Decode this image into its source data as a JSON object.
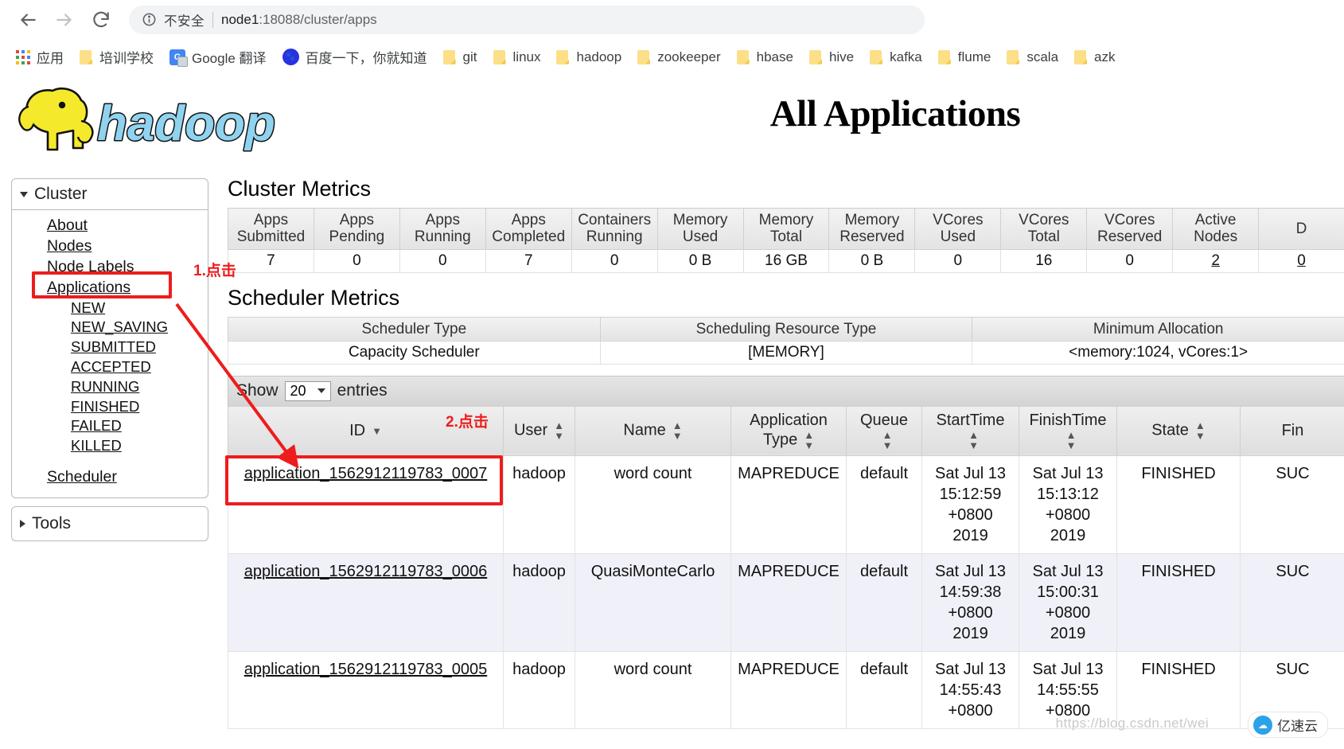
{
  "browser": {
    "back_icon": "back-arrow-icon",
    "forward_icon": "forward-arrow-icon",
    "reload_icon": "reload-icon",
    "info_icon": "info-circle-icon",
    "security_label": "不安全",
    "url_host": "node1",
    "url_rest": ":18088/cluster/apps",
    "bookmarks": [
      {
        "label": "应用",
        "icon": "apps-grid-icon"
      },
      {
        "label": "培训学校",
        "icon": "folder-icon"
      },
      {
        "label": "Google 翻译",
        "icon": "google-translate-icon"
      },
      {
        "label": "百度一下，你就知道",
        "icon": "baidu-icon"
      },
      {
        "label": "git",
        "icon": "folder-icon"
      },
      {
        "label": "linux",
        "icon": "folder-icon"
      },
      {
        "label": "hadoop",
        "icon": "folder-icon"
      },
      {
        "label": "zookeeper",
        "icon": "folder-icon"
      },
      {
        "label": "hbase",
        "icon": "folder-icon"
      },
      {
        "label": "hive",
        "icon": "folder-icon"
      },
      {
        "label": "kafka",
        "icon": "folder-icon"
      },
      {
        "label": "flume",
        "icon": "folder-icon"
      },
      {
        "label": "scala",
        "icon": "folder-icon"
      },
      {
        "label": "azk",
        "icon": "folder-icon"
      }
    ]
  },
  "page": {
    "logo_text": "hadoop",
    "title": "All Applications"
  },
  "sidebar": {
    "cluster_header": "Cluster",
    "tools_header": "Tools",
    "links": [
      {
        "label": "About",
        "sub": false
      },
      {
        "label": "Nodes",
        "sub": false
      },
      {
        "label": "Node Labels",
        "sub": false
      },
      {
        "label": "Applications",
        "sub": false
      },
      {
        "label": "NEW",
        "sub": true
      },
      {
        "label": "NEW_SAVING",
        "sub": true
      },
      {
        "label": "SUBMITTED",
        "sub": true
      },
      {
        "label": "ACCEPTED",
        "sub": true
      },
      {
        "label": "RUNNING",
        "sub": true
      },
      {
        "label": "FINISHED",
        "sub": true
      },
      {
        "label": "FAILED",
        "sub": true
      },
      {
        "label": "KILLED",
        "sub": true
      }
    ],
    "scheduler_link": "Scheduler"
  },
  "cluster_metrics": {
    "heading": "Cluster Metrics",
    "columns": [
      "Apps Submitted",
      "Apps Pending",
      "Apps Running",
      "Apps Completed",
      "Containers Running",
      "Memory Used",
      "Memory Total",
      "Memory Reserved",
      "VCores Used",
      "VCores Total",
      "VCores Reserved",
      "Active Nodes",
      "D"
    ],
    "values": [
      "7",
      "0",
      "0",
      "7",
      "0",
      "0 B",
      "16 GB",
      "0 B",
      "0",
      "16",
      "0",
      "2",
      "0"
    ]
  },
  "scheduler_metrics": {
    "heading": "Scheduler Metrics",
    "columns": [
      "Scheduler Type",
      "Scheduling Resource Type",
      "Minimum Allocation"
    ],
    "values": [
      "Capacity Scheduler",
      "[MEMORY]",
      "<memory:1024, vCores:1>"
    ]
  },
  "datatable": {
    "show_label": "Show",
    "entries_value": "20",
    "entries_label": "entries",
    "columns": [
      "ID",
      "User",
      "Name",
      "Application Type",
      "Queue",
      "StartTime",
      "FinishTime",
      "State",
      "Fin"
    ],
    "rows": [
      {
        "id": "application_1562912119783_0007",
        "user": "hadoop",
        "name": "word count",
        "app_type": "MAPREDUCE",
        "queue": "default",
        "start_time": "Sat Jul 13\n15:12:59\n+0800\n2019",
        "finish_time": "Sat Jul 13\n15:13:12\n+0800\n2019",
        "state": "FINISHED",
        "final_status": "SUC"
      },
      {
        "id": "application_1562912119783_0006",
        "user": "hadoop",
        "name": "QuasiMonteCarlo",
        "app_type": "MAPREDUCE",
        "queue": "default",
        "start_time": "Sat Jul 13\n14:59:38\n+0800\n2019",
        "finish_time": "Sat Jul 13\n15:00:31\n+0800\n2019",
        "state": "FINISHED",
        "final_status": "SUC"
      },
      {
        "id": "application_1562912119783_0005",
        "user": "hadoop",
        "name": "word count",
        "app_type": "MAPREDUCE",
        "queue": "default",
        "start_time": "Sat Jul 13\n14:55:43\n+0800",
        "finish_time": "Sat Jul 13\n14:55:55\n+0800",
        "state": "FINISHED",
        "final_status": "SUC"
      }
    ]
  },
  "annotations": {
    "step1": "1.点击",
    "step2": "2.点击",
    "accent_color": "#ee1c1c"
  },
  "watermarks": {
    "csdn": "https://blog.csdn.net/wei",
    "yisu": "亿速云"
  }
}
